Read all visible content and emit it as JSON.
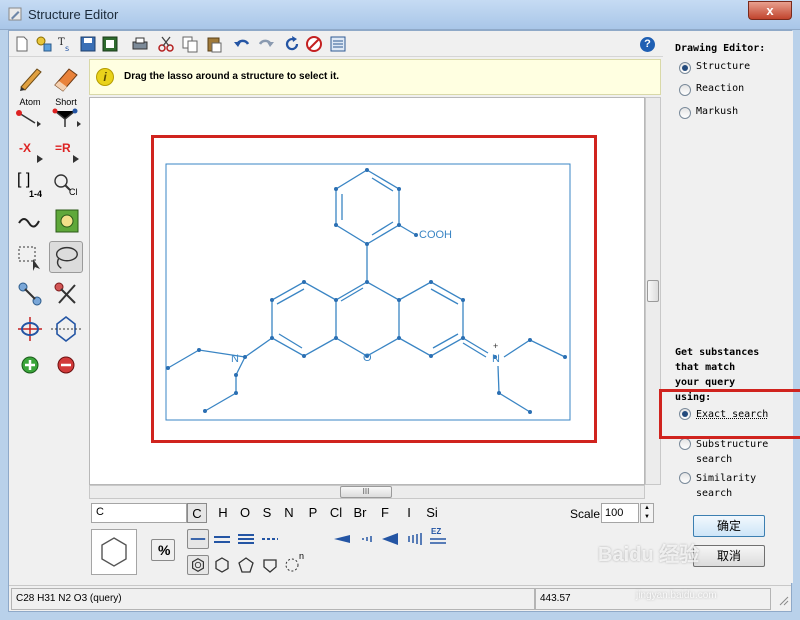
{
  "window": {
    "title": "Structure Editor",
    "close_label": "x"
  },
  "toolbar": {
    "buttons": [
      "new-document",
      "templates",
      "text",
      "save",
      "export",
      "print",
      "cut",
      "copy",
      "paste",
      "undo",
      "redo",
      "refresh",
      "clear",
      "properties"
    ],
    "help_label": "?"
  },
  "left_tools": {
    "atom_label": "Atom",
    "short_label": "Short",
    "x_label": "-X",
    "r_label": "=R",
    "bracket_index": "1-4",
    "cl_label": "Cl"
  },
  "info": {
    "text": "Drag the lasso around a structure to select it."
  },
  "molecule": {
    "cooh_label": "COOH",
    "o_label": "O",
    "n_left_label": "N",
    "n_right_label": "N",
    "charge_label": "+"
  },
  "hscroll_thumb_label": "III",
  "bottom": {
    "element_input_value": "C",
    "elements": [
      "C",
      "H",
      "O",
      "S",
      "N",
      "P",
      "Cl",
      "Br",
      "F",
      "I",
      "Si"
    ],
    "active_element": "C",
    "scale_label": "Scale",
    "scale_value": "100",
    "ez_label": "EZ",
    "n_label": "n",
    "percent_label": "%"
  },
  "right_panel": {
    "drawing_heading": "Drawing Editor:",
    "modes": [
      {
        "label": "Structure",
        "checked": true
      },
      {
        "label": "Reaction",
        "checked": false
      },
      {
        "label": "Markush",
        "checked": false
      }
    ],
    "query_heading": [
      "Get substances",
      "that match",
      "your query",
      "using:"
    ],
    "search_options": [
      {
        "label": "Exact search",
        "checked": true
      },
      {
        "label": "Substructure search",
        "checked": false
      },
      {
        "label": "Similarity search",
        "checked": false
      }
    ],
    "ok_label": "确定",
    "cancel_label": "取消"
  },
  "status": {
    "formula": "C28 H31 N2 O3 (query)",
    "mass": "443.57"
  },
  "watermark": {
    "brand": "Baidu 经验",
    "url": "jingyan.baidu.com"
  },
  "colors": {
    "bond": "#3a85c4",
    "atom": "#2b6fb3",
    "highlight": "#d0231e"
  }
}
